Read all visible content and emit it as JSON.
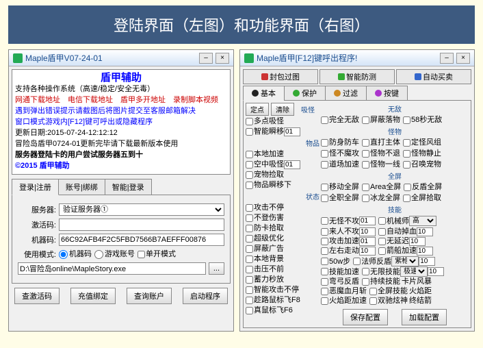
{
  "banner": "登陆界面（左图）和功能界面（右图）",
  "left": {
    "title": "Maple盾甲V07-24-01",
    "info_title": "盾甲辅助",
    "info_line1": "支持各种操作系统（高速/稳定/安全无毒）",
    "info_links": "网通下载地址　电信下载地址　盾甲多开地址　录制脚本视频",
    "info_line3": "遇到弹出错误提示请截图后将图片提交至客服邮箱解决",
    "info_line4": "窗口模式游戏内[F12]键可呼出或隐藏程序",
    "info_line5": "更新日期:2015-07-24-12:12:12",
    "info_line6": "冒险岛盾甲0724-01更新完毕请下载最新版本使用",
    "info_line7": "服务器登陆卡的用户尝试服务器五到十",
    "info_copy": "©2015 盾甲辅助",
    "tabs": [
      "登录|注册",
      "账号|绑绑",
      "智能|登录"
    ],
    "lbl_server": "服务器:",
    "val_server": "验证服务器①",
    "lbl_code": "激活码:",
    "lbl_machine": "机器码:",
    "val_machine": "66C92AFB4F2C5FBD7566B7AEFFF00876",
    "lbl_mode": "使用模式:",
    "mode_opts": [
      "机器码",
      "游戏账号",
      "单开模式"
    ],
    "lbl_path": "D:\\冒险岛online\\MapleStory.exe",
    "btns": [
      "查激活码",
      "充值绑定",
      "查询账户",
      "启动程序"
    ]
  },
  "right": {
    "title": "Maple盾甲[F12]键呼出程序!",
    "top_tabs": [
      "封包过图",
      "智能防测",
      "自动买卖"
    ],
    "sub_tabs": [
      "基本",
      "保护",
      "过滤",
      "按键"
    ],
    "col1": {
      "btn_fix": "定点",
      "btn_clear": "清除",
      "chk1": "多点吸怪",
      "chk2": "智能瞬移",
      "val2": "01",
      "chk3": "本地加速",
      "chk4": "空中吸怪",
      "val4": "01",
      "chk5": "宠物捡取",
      "chk6": "物品瞬移下",
      "chk7": "攻击不停",
      "chk8": "不登伤害",
      "chk9": "防卡拾取",
      "chk10": "超级优化",
      "chk11": "屏蔽广告",
      "chk12": "本地背景",
      "chk13": "击压不前",
      "chk14": "蓄力秒放",
      "chk15": "智能攻击不停",
      "chk16": "趁路鼠标飞F8",
      "chk17": "真鼠标飞F6"
    },
    "sec_absorb": "吸怪",
    "sec_items": "物品",
    "sec_state": "状态",
    "sec_invul": "无敌",
    "sec_monster": "怪物",
    "sec_fullscreen": "全屏",
    "sec_skill": "技能",
    "invul": [
      "完全无敌",
      "屏蔽落物",
      "58秒无敌"
    ],
    "monster": [
      "防身防车",
      "直打主体",
      "定怪风组",
      "怪不魔攻",
      "怪物不退",
      "怪物静止",
      "道场加速",
      "怪物一线",
      "召唤宠物"
    ],
    "fullscreen": [
      "移动全屏",
      "Area全屏",
      "反盾全屏",
      "全职全屏",
      "冰龙全屏",
      "全屏拾取"
    ],
    "skill_row1": {
      "a": "无怪不攻",
      "v": "01",
      "b": "机械师",
      "sel": "高"
    },
    "skill_rows": [
      {
        "a": "来人不攻",
        "va": "10",
        "b": "自动掉血",
        "vb": "10"
      },
      {
        "a": "攻击加速",
        "va": "01",
        "b": "无延迟",
        "vb": "10"
      },
      {
        "a": "左右走动",
        "va": "10",
        "b": "箭船加速",
        "vb": "10"
      }
    ],
    "special": [
      {
        "a": "50w步",
        "b": "法师反盾",
        "sel": "紫枪",
        "v": "10"
      },
      {
        "a": "技能加速",
        "b": "无限技能",
        "sel": "极速",
        "v": "10"
      },
      {
        "a": "弯弓反盾",
        "b": "持续技能",
        "t": "卡片风暴"
      },
      {
        "a": "恶魔血月斩",
        "b": "全屏技能",
        "t": "火焰距"
      },
      {
        "a": "火焰距加速",
        "b": "双驰炫神",
        "t": "终结箭"
      }
    ],
    "btn_save": "保存配置",
    "btn_load": "加载配置"
  }
}
